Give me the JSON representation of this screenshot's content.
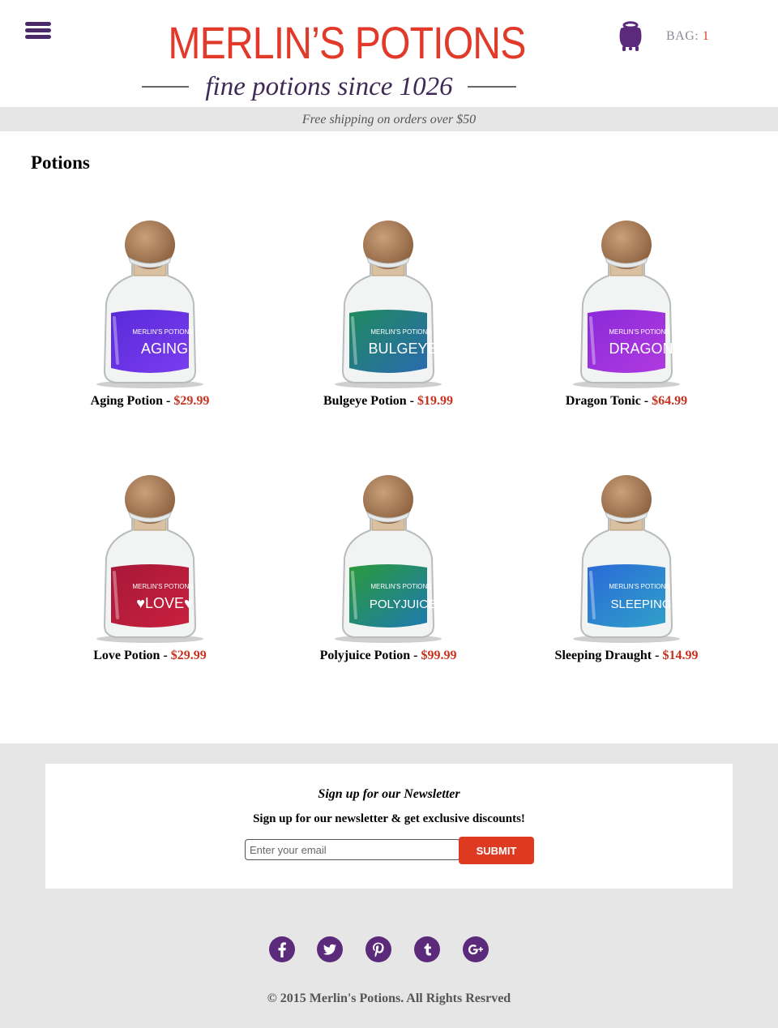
{
  "header": {
    "menu_icon": "hamburger-menu-icon",
    "logo_title": "MERLIN’S POTIONS",
    "logo_tagline": "fine potions since 1026",
    "cart_icon": "cauldron-icon",
    "bag_label": "BAG:",
    "bag_count": "1"
  },
  "promo": {
    "text": "Free shipping on orders over $50"
  },
  "main": {
    "title": "Potions",
    "products": [
      {
        "name": "Aging Potion",
        "price": "$29.99",
        "label": "AGING",
        "liquid_color": "#5a2bd8",
        "liquid_color_2": "#7a3cf0"
      },
      {
        "name": "Bulgeye Potion",
        "price": "$19.99",
        "label": "BULGEYE",
        "liquid_color": "#1f8a5e",
        "liquid_color_2": "#2a6ab0"
      },
      {
        "name": "Dragon Tonic",
        "price": "$64.99",
        "label": "DRAGON",
        "liquid_color": "#8a2ad8",
        "liquid_color_2": "#b03ae0"
      },
      {
        "name": "Love Potion",
        "price": "$29.99",
        "label": "♥LOVE♥",
        "liquid_color": "#a8183a",
        "liquid_color_2": "#c8203c"
      },
      {
        "name": "Polyjuice Potion",
        "price": "$99.99",
        "label": "POLYJUICE",
        "liquid_color": "#2a9a3a",
        "liquid_color_2": "#1f7ab0"
      },
      {
        "name": "Sleeping Draught",
        "price": "$14.99",
        "label": "SLEEPING",
        "liquid_color": "#2a6ad8",
        "liquid_color_2": "#30a0c8"
      }
    ],
    "bottle_brand": "MERLIN'S POTIONS",
    "price_color": "#c8321e"
  },
  "newsletter": {
    "title": "Sign up for our Newsletter",
    "text": "Sign up for our newsletter & get exclusive discounts!",
    "placeholder": "Enter your email",
    "submit_label": "SUBMIT"
  },
  "social": [
    {
      "name": "facebook-icon"
    },
    {
      "name": "twitter-icon"
    },
    {
      "name": "pinterest-icon"
    },
    {
      "name": "tumblr-icon"
    },
    {
      "name": "google-plus-icon"
    }
  ],
  "footer": {
    "copyright": "© 2015 Merlin's Potions. All Rights Resrved"
  },
  "colors": {
    "accent_red": "#de3a22",
    "brand_purple": "#5b2a7a",
    "promo_bg": "#e6e6e6"
  }
}
